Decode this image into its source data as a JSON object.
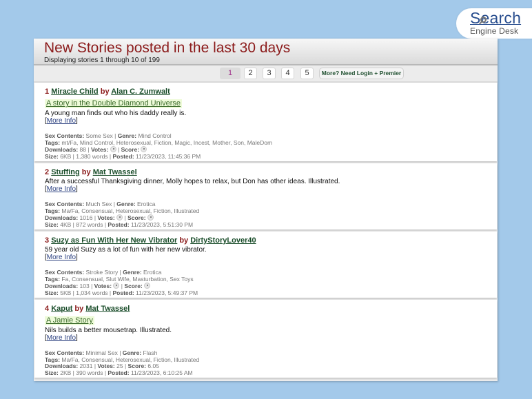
{
  "logo": {
    "line1": "Search",
    "line2": "Engine Desk"
  },
  "header": {
    "title": "New Stories posted in the last 30 days",
    "subtitle": "Displaying stories 1 through 10 of 199"
  },
  "pagination": {
    "pages": [
      "1",
      "2",
      "3",
      "4",
      "5"
    ],
    "current": "1",
    "more_label": "More? Need Login + Premier"
  },
  "labels": {
    "by": "by",
    "more_info": "More Info",
    "sex_contents": "Sex Contents:",
    "genre": "Genre:",
    "tags": "Tags:",
    "downloads": "Downloads:",
    "votes": "Votes:",
    "score": "Score:",
    "size": "Size:",
    "posted": "Posted:"
  },
  "stories": [
    {
      "num": "1",
      "title": "Miracle Child",
      "author": "Alan C. Zumwalt",
      "series": "A story in the Double Diamond Universe",
      "description": "A young man finds out who his daddy really is.",
      "sex_contents": "Some Sex",
      "genre": "Mind Control",
      "tags": "mt/Fa, Mind Control, Heterosexual, Fiction, Magic, Incest, Mother, Son, MaleDom",
      "downloads": "88",
      "votes": null,
      "score": null,
      "size": "6KB",
      "words": "1,380 words",
      "posted": "11/23/2023, 11:45:36 PM"
    },
    {
      "num": "2",
      "title": "Stuffing",
      "author": "Mat Twassel",
      "series": null,
      "description": "After a successful Thanksgiving dinner, Molly hopes to relax, but Don has other ideas. Illustrated.",
      "sex_contents": "Much Sex",
      "genre": "Erotica",
      "tags": "Ma/Fa, Consensual, Heterosexual, Fiction, Illustrated",
      "downloads": "1016",
      "votes": null,
      "score": null,
      "size": "4KB",
      "words": "872 words",
      "posted": "11/23/2023, 5:51:30 PM"
    },
    {
      "num": "3",
      "title": "Suzy as Fun With Her New Vibrator",
      "author": "DirtyStoryLover40",
      "series": null,
      "description": "59 year old Suzy as a lot of fun with her new vibrator.",
      "sex_contents": "Stroke Story",
      "genre": "Erotica",
      "tags": "Fa, Consensual, Slut Wife, Masturbation, Sex Toys",
      "downloads": "103",
      "votes": null,
      "score": null,
      "size": "5KB",
      "words": "1,034 words",
      "posted": "11/23/2023, 5:49:37 PM"
    },
    {
      "num": "4",
      "title": "Kaput",
      "author": "Mat Twassel",
      "series": "A Jamie Story",
      "description": "Nils builds a better mousetrap. Illustrated.",
      "sex_contents": "Minimal Sex",
      "genre": "Flash",
      "tags": "Ma/Fa, Consensual, Heterosexual, Fiction, Illustrated",
      "downloads": "2031",
      "votes": "25",
      "score": "6.05",
      "size": "2KB",
      "words": "390 words",
      "posted": "11/23/2023, 6:10:25 AM"
    }
  ]
}
